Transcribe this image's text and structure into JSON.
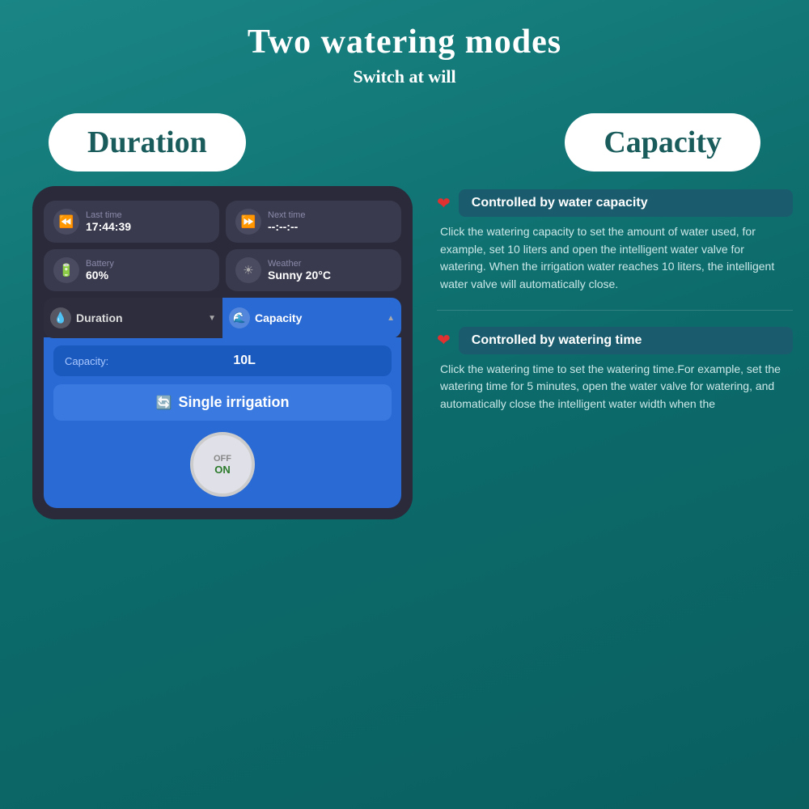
{
  "header": {
    "main_title": "Two watering modes",
    "sub_title": "Switch at will"
  },
  "modes": {
    "left_label": "Duration",
    "right_label": "Capacity"
  },
  "phone": {
    "cards": [
      {
        "icon": "⏪",
        "label": "Last time",
        "value": "17:44:39"
      },
      {
        "icon": "⏩",
        "label": "Next time",
        "value": "--:--:--"
      },
      {
        "icon": "🔋",
        "label": "Battery",
        "value": "60%"
      },
      {
        "icon": "☀",
        "label": "Weather",
        "value": "Sunny 20°C"
      }
    ],
    "mode_tabs": [
      {
        "label": "Duration",
        "icon": "💧",
        "arrow": "▼",
        "active": false
      },
      {
        "label": "Capacity",
        "icon": "🌊",
        "arrow": "▲",
        "active": true
      }
    ],
    "capacity_label": "Capacity:",
    "capacity_value": "10L",
    "single_irrigation_label": "Single irrigation",
    "toggle_off": "OFF",
    "toggle_on": "ON"
  },
  "features": [
    {
      "title": "Controlled by water capacity",
      "description": "Click the watering capacity to set the amount of water used, for example, set 10 liters and open the intelligent water valve for watering. When the irrigation water reaches 10 liters, the intelligent water valve will automatically close."
    },
    {
      "title": "Controlled by watering time",
      "description": "Click the watering time to set the watering time.For example, set the watering time for 5 minutes, open the water valve for watering, and automatically close the intelligent water width when the"
    }
  ]
}
